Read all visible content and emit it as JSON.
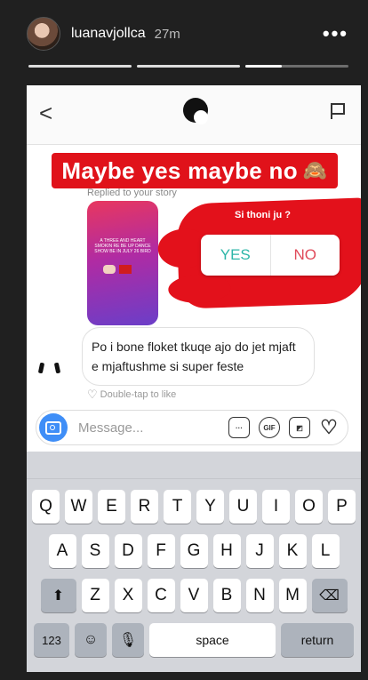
{
  "story": {
    "username": "luanavjollca",
    "time": "27m",
    "more": "•••"
  },
  "dm": {
    "back": "<",
    "banner": "Maybe yes maybe no",
    "banner_emoji": "🙈",
    "replied": "Replied to your story",
    "thumb_text": "A THREE AND HEART SMOKIN RE BE UP DANCE SHOW BE IN JULY 26 BIRD",
    "poll": {
      "question": "Si thoni ju ?",
      "yes": "YES",
      "no": "NO"
    },
    "message": "Po i bone floket tkuqe  ajo do  jet mjaft e mjaftushme si super feste",
    "like_hint": "Double-tap to like",
    "composer": {
      "placeholder": "Message...",
      "gif_label": "GIF"
    }
  },
  "keyboard": {
    "row1": [
      "Q",
      "W",
      "E",
      "R",
      "T",
      "Y",
      "U",
      "I",
      "O",
      "P"
    ],
    "row2": [
      "A",
      "S",
      "D",
      "F",
      "G",
      "H",
      "J",
      "K",
      "L"
    ],
    "row3": [
      "Z",
      "X",
      "C",
      "V",
      "B",
      "N",
      "M"
    ],
    "shift": "⬆",
    "delete": "⌫",
    "num": "123",
    "emoji": "☺",
    "mic": "🎙",
    "space": "space",
    "return": "return"
  }
}
